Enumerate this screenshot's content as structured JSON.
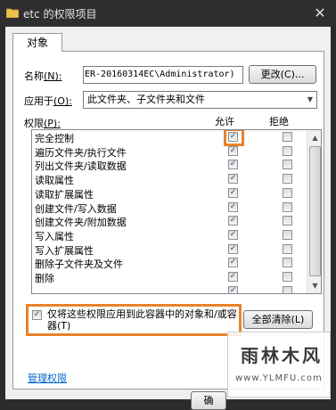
{
  "window": {
    "title": "etc 的权限项目",
    "close_glyph": "✕"
  },
  "tab": {
    "label": "对象"
  },
  "name_row": {
    "label": "名称",
    "hotkey": "(N):",
    "value": "ER-20160314EC\\Administrator)",
    "change_button": "更改(C)..."
  },
  "apply_to": {
    "label": "应用于",
    "hotkey": "(O):",
    "value": "此文件夹、子文件夹和文件"
  },
  "permissions": {
    "label": "权限",
    "hotkey": "(P):",
    "allow_header": "允许",
    "deny_header": "拒绝",
    "items": [
      {
        "label": "完全控制",
        "allow": true,
        "deny": false
      },
      {
        "label": "遍历文件夹/执行文件",
        "allow": true,
        "deny": false
      },
      {
        "label": "列出文件夹/读取数据",
        "allow": true,
        "deny": false
      },
      {
        "label": "读取属性",
        "allow": true,
        "deny": false
      },
      {
        "label": "读取扩展属性",
        "allow": true,
        "deny": false
      },
      {
        "label": "创建文件/写入数据",
        "allow": true,
        "deny": false
      },
      {
        "label": "创建文件夹/附加数据",
        "allow": true,
        "deny": false
      },
      {
        "label": "写入属性",
        "allow": true,
        "deny": false
      },
      {
        "label": "写入扩展属性",
        "allow": true,
        "deny": false
      },
      {
        "label": "删除子文件夹及文件",
        "allow": true,
        "deny": false
      },
      {
        "label": "删除",
        "allow": true,
        "deny": false
      },
      {
        "label": "",
        "allow": true,
        "deny": false
      }
    ]
  },
  "apply_only": {
    "checked": true,
    "text": "仅将这些权限应用到此容器中的对象和/或容器(T)"
  },
  "clear_all_button": "全部清除(L)",
  "manage_link": "管理权限",
  "ok_button_partial": "确",
  "watermark": {
    "main": "雨林木风",
    "sub": "www.YLMFU.com"
  },
  "colors": {
    "highlight": "#e8822a",
    "link": "#0066cc",
    "titlebar": "#2e2e2e"
  }
}
